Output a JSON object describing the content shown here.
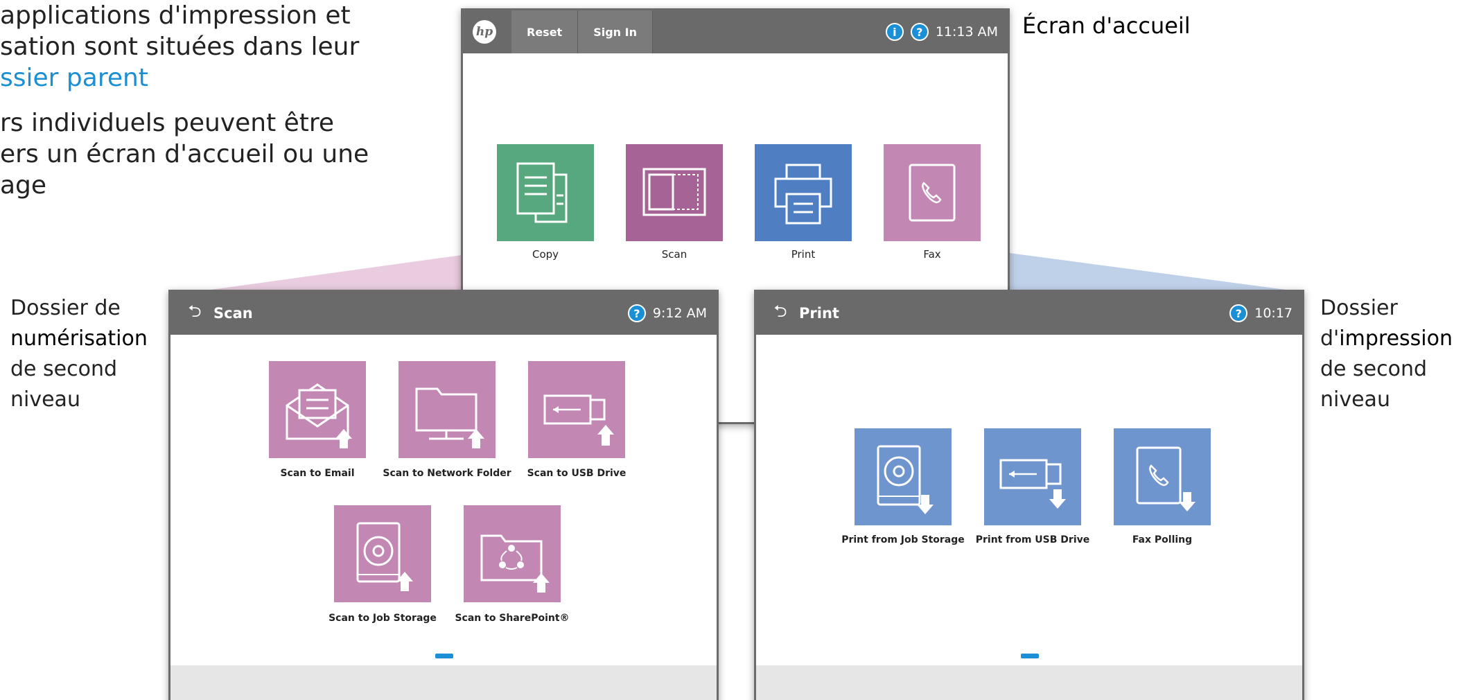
{
  "intro": {
    "line1": "applications d'impression et\nsation sont situées dans leur",
    "line1_blue": "ssier parent",
    "line2": "rs individuels peuvent être\ners un écran d'accueil ou une\nage"
  },
  "home_screen": {
    "label": "Écran d'accueil",
    "topbar": {
      "logo": "hp",
      "buttons": [
        "Reset",
        "Sign In"
      ],
      "info_icon": "i",
      "help_icon": "?",
      "time": "11:13 AM"
    },
    "tiles": [
      {
        "label": "Copy",
        "color": "#57a87f",
        "icon": "copy-icon"
      },
      {
        "label": "Scan",
        "color": "#a66496",
        "icon": "scan-icon"
      },
      {
        "label": "Print",
        "color": "#4f7fc2",
        "icon": "printer-icon"
      },
      {
        "label": "Fax",
        "color": "#c287b3",
        "icon": "fax-icon"
      }
    ]
  },
  "scan_folder": {
    "side_label": {
      "line1": "Dossier de",
      "bold": "numérisation",
      "line3": "de second",
      "line4": "niveau"
    },
    "topbar": {
      "back_icon": "⮌",
      "title": "Scan",
      "help_icon": "?",
      "time": "9:12 AM"
    },
    "tiles": [
      {
        "label": "Scan to Email",
        "icon": "email-upload-icon"
      },
      {
        "label": "Scan to Network Folder",
        "icon": "network-folder-upload-icon"
      },
      {
        "label": "Scan to USB Drive",
        "icon": "usb-upload-icon"
      },
      {
        "label": "Scan to Job Storage",
        "icon": "job-storage-upload-icon"
      },
      {
        "label": "Scan to SharePoint®",
        "icon": "sharepoint-upload-icon"
      }
    ],
    "color": "#c287b3"
  },
  "print_folder": {
    "side_label": {
      "line1": "Dossier",
      "line2_prefix": "d'",
      "bold": "impression",
      "line3": "de second",
      "line4": "niveau"
    },
    "topbar": {
      "back_icon": "⮌",
      "title": "Print",
      "help_icon": "?",
      "time": "10:17"
    },
    "tiles": [
      {
        "label": "Print from Job Storage",
        "icon": "job-storage-download-icon"
      },
      {
        "label": "Print from USB Drive",
        "icon": "usb-download-icon"
      },
      {
        "label": "Fax Polling",
        "icon": "fax-download-icon"
      }
    ],
    "color": "#6f95cf"
  }
}
